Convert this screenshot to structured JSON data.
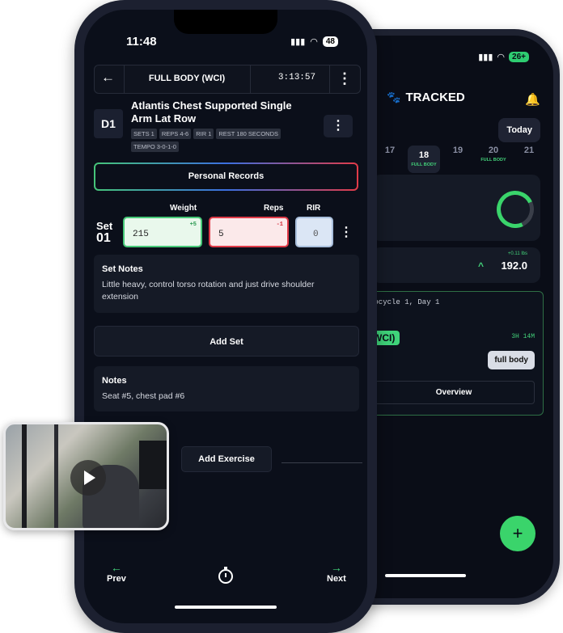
{
  "back_phone": {
    "signal_text": ".ıll",
    "battery": "26+",
    "app_title": "TRACKED",
    "today_label": "Today",
    "days": [
      {
        "num": "17",
        "sub": ""
      },
      {
        "num": "18",
        "sub": "FULL BODY"
      },
      {
        "num": "19",
        "sub": ""
      },
      {
        "num": "20",
        "sub": "FULL BODY"
      },
      {
        "num": "21",
        "sub": ""
      }
    ],
    "bodyweight_delta": "+0.11 lbs",
    "bodyweight": "192.0",
    "workout_subtitle": "rocycle 1, Day 1",
    "workout_badge": "WCI)",
    "workout_duration": "3H 14M",
    "workout_partial": "1",
    "workout_tag": "full body",
    "overview_label": "Overview",
    "fab_label": "+"
  },
  "front_phone": {
    "time": "11:48",
    "battery": "48",
    "workout_title": "FULL BODY (WCI)",
    "timer": "3:13:57",
    "exercise_code": "D1",
    "exercise_name": "Atlantis Chest Supported Single Arm Lat Row",
    "tags": [
      "SETS 1",
      "REPS 4-6",
      "RIR 1",
      "REST 180 SECONDS",
      "TEMPO 3-0-1-0"
    ],
    "personal_records_label": "Personal Records",
    "col_weight": "Weight",
    "col_reps": "Reps",
    "col_rir": "RIR",
    "set_label": "Set",
    "set_number": "01",
    "weight_value": "215",
    "weight_delta": "+5",
    "reps_value": "5",
    "reps_delta": "-1",
    "rir_value": "0",
    "set_notes_title": "Set Notes",
    "set_notes_text": "Little heavy, control torso rotation and just drive shoulder extension",
    "add_set_label": "Add Set",
    "notes_title": "Notes",
    "notes_text": "Seat #5, chest pad #6",
    "add_exercise_label": "Add Exercise",
    "prev_label": "Prev",
    "next_label": "Next"
  },
  "colors": {
    "accent_green": "#3ad46b",
    "danger_red": "#df3b48",
    "background": "#0b0f1a"
  },
  "icons": [
    "back-arrow-icon",
    "kebab-menu-icon",
    "stopwatch-icon",
    "bell-icon",
    "paw-icon",
    "play-icon",
    "wifi-icon",
    "signal-icon"
  ]
}
